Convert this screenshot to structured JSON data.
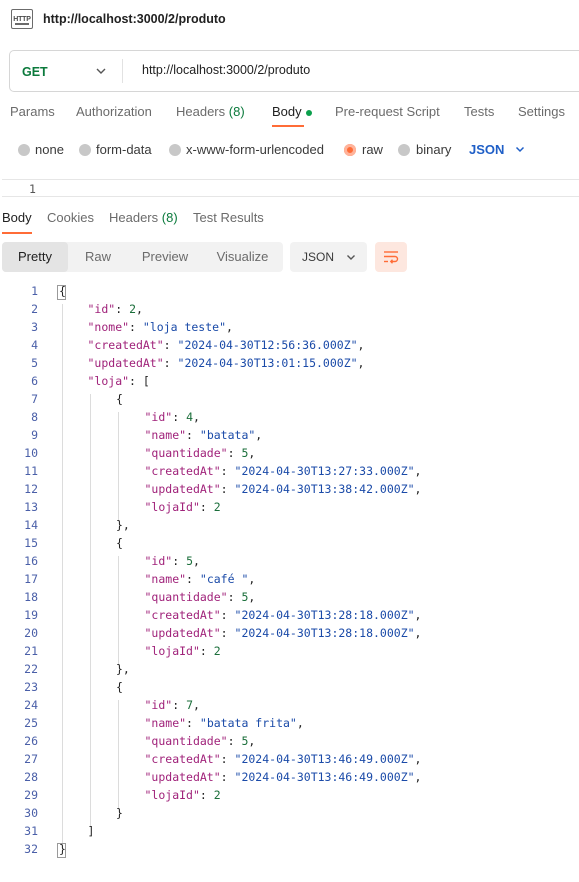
{
  "window": {
    "title": "http://localhost:3000/2/produto",
    "icon": "http-icon"
  },
  "request": {
    "method": "GET",
    "url": "http://localhost:3000/2/produto"
  },
  "request_tabs": [
    {
      "label": "Params"
    },
    {
      "label": "Authorization"
    },
    {
      "label": "Headers",
      "count": "(8)"
    },
    {
      "label": "Body",
      "active": true
    },
    {
      "label": "Pre-request Script"
    },
    {
      "label": "Tests"
    },
    {
      "label": "Settings"
    }
  ],
  "body_types": [
    {
      "label": "none"
    },
    {
      "label": "form-data"
    },
    {
      "label": "x-www-form-urlencoded"
    },
    {
      "label": "raw",
      "selected": true
    },
    {
      "label": "binary"
    }
  ],
  "body_format": "JSON",
  "request_editor_line": "1",
  "response_tabs": [
    {
      "label": "Body",
      "active": true
    },
    {
      "label": "Cookies"
    },
    {
      "label": "Headers",
      "count": "(8)"
    },
    {
      "label": "Test Results"
    }
  ],
  "view_modes": [
    {
      "label": "Pretty",
      "active": true
    },
    {
      "label": "Raw"
    },
    {
      "label": "Preview"
    },
    {
      "label": "Visualize"
    }
  ],
  "response_format": "JSON",
  "colors": {
    "accent": "#ff6c37",
    "method_get": "#0b7a3c",
    "json_key": "#a0227a",
    "json_string": "#1a4aa8",
    "json_number": "#1a6e3a"
  },
  "code_lines": [
    {
      "n": "1",
      "i": 0,
      "parts": [
        [
          "p",
          "{"
        ]
      ]
    },
    {
      "n": "2",
      "i": 1,
      "parts": [
        [
          "k",
          "\"id\""
        ],
        [
          "p",
          ": "
        ],
        [
          "n",
          "2"
        ],
        [
          "p",
          ","
        ]
      ]
    },
    {
      "n": "3",
      "i": 1,
      "parts": [
        [
          "k",
          "\"nome\""
        ],
        [
          "p",
          ": "
        ],
        [
          "s",
          "\"loja teste\""
        ],
        [
          "p",
          ","
        ]
      ]
    },
    {
      "n": "4",
      "i": 1,
      "parts": [
        [
          "k",
          "\"createdAt\""
        ],
        [
          "p",
          ": "
        ],
        [
          "s",
          "\"2024-04-30T12:56:36.000Z\""
        ],
        [
          "p",
          ","
        ]
      ]
    },
    {
      "n": "5",
      "i": 1,
      "parts": [
        [
          "k",
          "\"updatedAt\""
        ],
        [
          "p",
          ": "
        ],
        [
          "s",
          "\"2024-04-30T13:01:15.000Z\""
        ],
        [
          "p",
          ","
        ]
      ]
    },
    {
      "n": "6",
      "i": 1,
      "parts": [
        [
          "k",
          "\"loja\""
        ],
        [
          "p",
          ": ["
        ]
      ]
    },
    {
      "n": "7",
      "i": 2,
      "parts": [
        [
          "p",
          "{"
        ]
      ]
    },
    {
      "n": "8",
      "i": 3,
      "parts": [
        [
          "k",
          "\"id\""
        ],
        [
          "p",
          ": "
        ],
        [
          "n",
          "4"
        ],
        [
          "p",
          ","
        ]
      ]
    },
    {
      "n": "9",
      "i": 3,
      "parts": [
        [
          "k",
          "\"name\""
        ],
        [
          "p",
          ": "
        ],
        [
          "s",
          "\"batata\""
        ],
        [
          "p",
          ","
        ]
      ]
    },
    {
      "n": "10",
      "i": 3,
      "parts": [
        [
          "k",
          "\"quantidade\""
        ],
        [
          "p",
          ": "
        ],
        [
          "n",
          "5"
        ],
        [
          "p",
          ","
        ]
      ]
    },
    {
      "n": "11",
      "i": 3,
      "parts": [
        [
          "k",
          "\"createdAt\""
        ],
        [
          "p",
          ": "
        ],
        [
          "s",
          "\"2024-04-30T13:27:33.000Z\""
        ],
        [
          "p",
          ","
        ]
      ]
    },
    {
      "n": "12",
      "i": 3,
      "parts": [
        [
          "k",
          "\"updatedAt\""
        ],
        [
          "p",
          ": "
        ],
        [
          "s",
          "\"2024-04-30T13:38:42.000Z\""
        ],
        [
          "p",
          ","
        ]
      ]
    },
    {
      "n": "13",
      "i": 3,
      "parts": [
        [
          "k",
          "\"lojaId\""
        ],
        [
          "p",
          ": "
        ],
        [
          "n",
          "2"
        ]
      ]
    },
    {
      "n": "14",
      "i": 2,
      "parts": [
        [
          "p",
          "},"
        ]
      ]
    },
    {
      "n": "15",
      "i": 2,
      "parts": [
        [
          "p",
          "{"
        ]
      ]
    },
    {
      "n": "16",
      "i": 3,
      "parts": [
        [
          "k",
          "\"id\""
        ],
        [
          "p",
          ": "
        ],
        [
          "n",
          "5"
        ],
        [
          "p",
          ","
        ]
      ]
    },
    {
      "n": "17",
      "i": 3,
      "parts": [
        [
          "k",
          "\"name\""
        ],
        [
          "p",
          ": "
        ],
        [
          "s",
          "\"café \""
        ],
        [
          "p",
          ","
        ]
      ]
    },
    {
      "n": "18",
      "i": 3,
      "parts": [
        [
          "k",
          "\"quantidade\""
        ],
        [
          "p",
          ": "
        ],
        [
          "n",
          "5"
        ],
        [
          "p",
          ","
        ]
      ]
    },
    {
      "n": "19",
      "i": 3,
      "parts": [
        [
          "k",
          "\"createdAt\""
        ],
        [
          "p",
          ": "
        ],
        [
          "s",
          "\"2024-04-30T13:28:18.000Z\""
        ],
        [
          "p",
          ","
        ]
      ]
    },
    {
      "n": "20",
      "i": 3,
      "parts": [
        [
          "k",
          "\"updatedAt\""
        ],
        [
          "p",
          ": "
        ],
        [
          "s",
          "\"2024-04-30T13:28:18.000Z\""
        ],
        [
          "p",
          ","
        ]
      ]
    },
    {
      "n": "21",
      "i": 3,
      "parts": [
        [
          "k",
          "\"lojaId\""
        ],
        [
          "p",
          ": "
        ],
        [
          "n",
          "2"
        ]
      ]
    },
    {
      "n": "22",
      "i": 2,
      "parts": [
        [
          "p",
          "},"
        ]
      ]
    },
    {
      "n": "23",
      "i": 2,
      "parts": [
        [
          "p",
          "{"
        ]
      ]
    },
    {
      "n": "24",
      "i": 3,
      "parts": [
        [
          "k",
          "\"id\""
        ],
        [
          "p",
          ": "
        ],
        [
          "n",
          "7"
        ],
        [
          "p",
          ","
        ]
      ]
    },
    {
      "n": "25",
      "i": 3,
      "parts": [
        [
          "k",
          "\"name\""
        ],
        [
          "p",
          ": "
        ],
        [
          "s",
          "\"batata frita\""
        ],
        [
          "p",
          ","
        ]
      ]
    },
    {
      "n": "26",
      "i": 3,
      "parts": [
        [
          "k",
          "\"quantidade\""
        ],
        [
          "p",
          ": "
        ],
        [
          "n",
          "5"
        ],
        [
          "p",
          ","
        ]
      ]
    },
    {
      "n": "27",
      "i": 3,
      "parts": [
        [
          "k",
          "\"createdAt\""
        ],
        [
          "p",
          ": "
        ],
        [
          "s",
          "\"2024-04-30T13:46:49.000Z\""
        ],
        [
          "p",
          ","
        ]
      ]
    },
    {
      "n": "28",
      "i": 3,
      "parts": [
        [
          "k",
          "\"updatedAt\""
        ],
        [
          "p",
          ": "
        ],
        [
          "s",
          "\"2024-04-30T13:46:49.000Z\""
        ],
        [
          "p",
          ","
        ]
      ]
    },
    {
      "n": "29",
      "i": 3,
      "parts": [
        [
          "k",
          "\"lojaId\""
        ],
        [
          "p",
          ": "
        ],
        [
          "n",
          "2"
        ]
      ]
    },
    {
      "n": "30",
      "i": 2,
      "parts": [
        [
          "p",
          "}"
        ]
      ]
    },
    {
      "n": "31",
      "i": 1,
      "parts": [
        [
          "p",
          "]"
        ]
      ]
    },
    {
      "n": "32",
      "i": 0,
      "parts": [
        [
          "p",
          "}"
        ]
      ]
    }
  ]
}
